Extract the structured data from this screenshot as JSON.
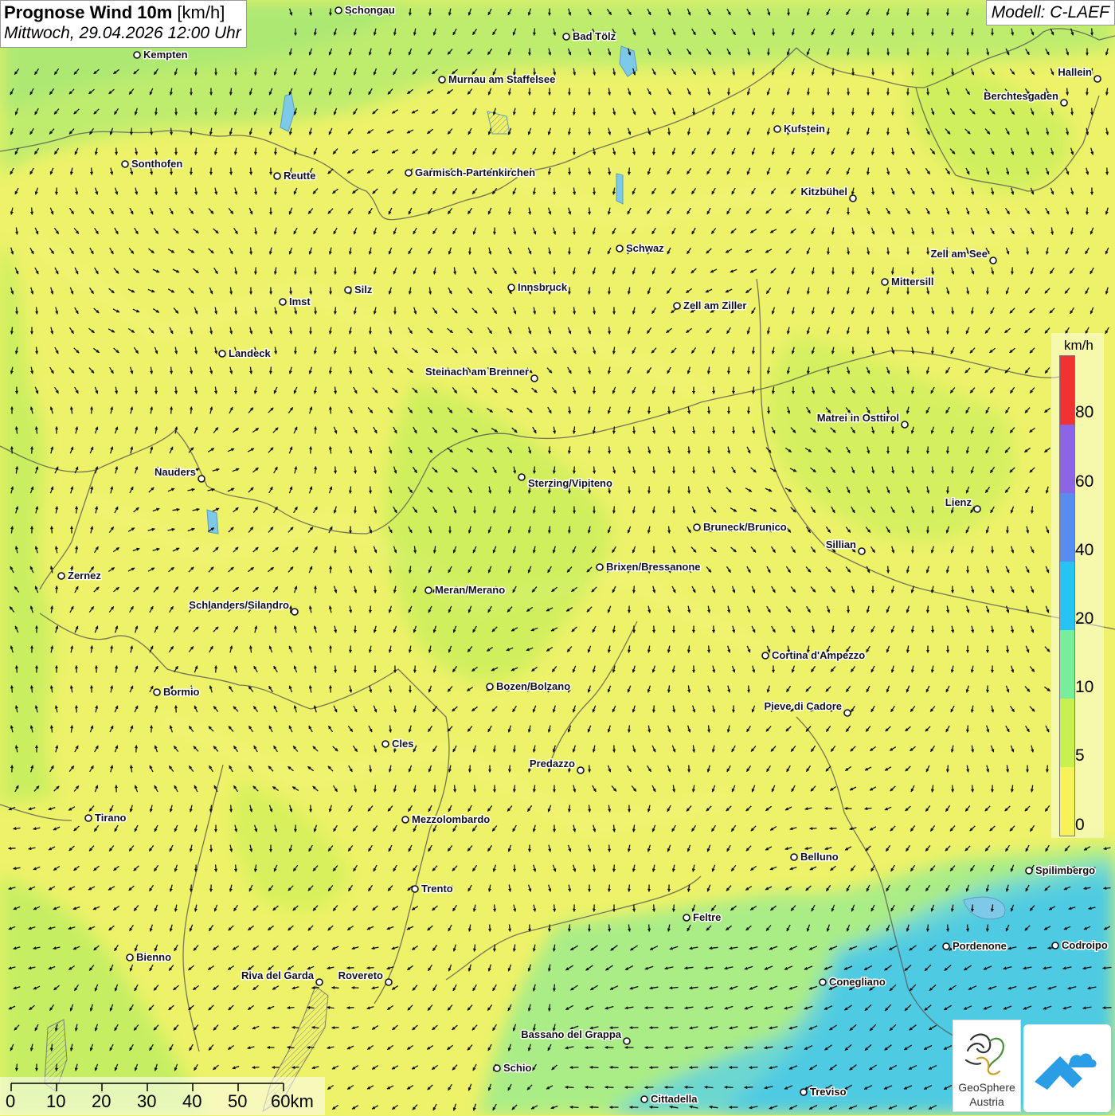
{
  "header": {
    "title_bold": "Prognose Wind 10m",
    "title_unit": "[km/h]",
    "datetime": "Mittwoch, 29.04.2026 12:00 Uhr",
    "model": "Modell: C-LAEF"
  },
  "legend": {
    "unit": "km/h",
    "ticks": [
      "80",
      "60",
      "40",
      "20",
      "10",
      "5",
      "0"
    ],
    "colors": [
      "#f03232",
      "#8c64e6",
      "#5a8cf0",
      "#28c3f5",
      "#78ee9a",
      "#c8f050",
      "#f8f25a"
    ]
  },
  "scalebar": {
    "labels": [
      "0",
      "10",
      "20",
      "30",
      "40",
      "50",
      "60km"
    ]
  },
  "logos": {
    "geosphere_line1": "GeoSphere",
    "geosphere_line2": "Austria"
  },
  "cities": [
    {
      "name": "Schongau"
    },
    {
      "name": "Bad Tölz"
    },
    {
      "name": "Kempten"
    },
    {
      "name": "Murnau am Staffelsee"
    },
    {
      "name": "Hallein"
    },
    {
      "name": "Berchtesgaden"
    },
    {
      "name": "Kufstein"
    },
    {
      "name": "Sonthofen"
    },
    {
      "name": "Reutte"
    },
    {
      "name": "Garmisch-Partenkirchen"
    },
    {
      "name": "Kitzbühel"
    },
    {
      "name": "Schwaz"
    },
    {
      "name": "Zell am See"
    },
    {
      "name": "Mittersill"
    },
    {
      "name": "Imst"
    },
    {
      "name": "Silz"
    },
    {
      "name": "Innsbruck"
    },
    {
      "name": "Zell am Ziller"
    },
    {
      "name": "Landeck"
    },
    {
      "name": "Steinach am Brenner"
    },
    {
      "name": "Matrei in Osttirol"
    },
    {
      "name": "Nauders"
    },
    {
      "name": "Sterzing/Vipiteno"
    },
    {
      "name": "Lienz"
    },
    {
      "name": "Bruneck/Brunico"
    },
    {
      "name": "Sillian"
    },
    {
      "name": "Zernez"
    },
    {
      "name": "Brixen/Bressanone"
    },
    {
      "name": "Meran/Merano"
    },
    {
      "name": "Schlanders/Silandro"
    },
    {
      "name": "Cortina d'Ampezzo"
    },
    {
      "name": "Bozen/Bolzano"
    },
    {
      "name": "Bormio"
    },
    {
      "name": "Pieve di Cadore"
    },
    {
      "name": "Cles"
    },
    {
      "name": "Predazzo"
    },
    {
      "name": "Tirano"
    },
    {
      "name": "Mezzolombardo"
    },
    {
      "name": "Belluno"
    },
    {
      "name": "Spilimbergo"
    },
    {
      "name": "Trento"
    },
    {
      "name": "Feltre"
    },
    {
      "name": "Pordenone"
    },
    {
      "name": "Codroipo"
    },
    {
      "name": "Bienno"
    },
    {
      "name": "Riva del Garda"
    },
    {
      "name": "Rovereto"
    },
    {
      "name": "Conegliano"
    },
    {
      "name": "Bassano del Grappa"
    },
    {
      "name": "Schio"
    },
    {
      "name": "Treviso"
    },
    {
      "name": "Cittadella"
    }
  ]
}
